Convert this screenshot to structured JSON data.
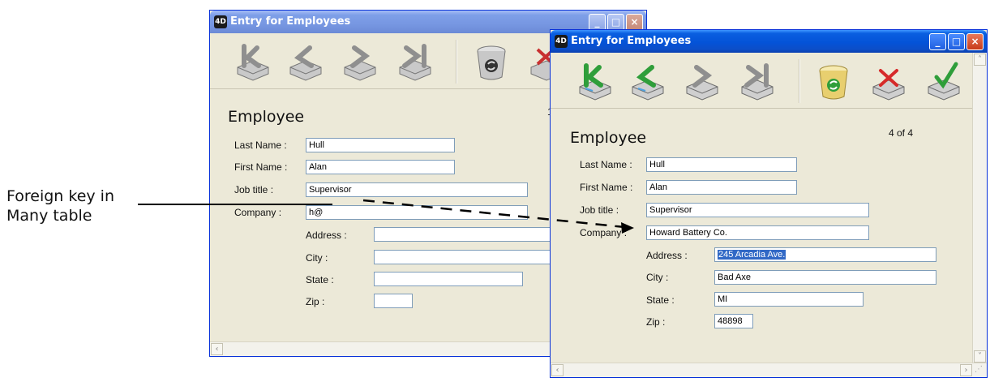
{
  "annotation": {
    "line1": "Foreign key in",
    "line2": "Many table"
  },
  "back_window": {
    "title": "Entry for Employees",
    "title_icon": "4D",
    "form_title": "Employee",
    "counter": "1",
    "fields": {
      "last_name": {
        "label": "Last Name :",
        "value": "Hull"
      },
      "first_name": {
        "label": "First Name :",
        "value": "Alan"
      },
      "job_title": {
        "label": "Job title :",
        "value": "Supervisor"
      },
      "company": {
        "label": "Company :",
        "value": "h@"
      },
      "address": {
        "label": "Address :",
        "value": ""
      },
      "city": {
        "label": "City :",
        "value": ""
      },
      "state": {
        "label": "State :",
        "value": ""
      },
      "zip": {
        "label": "Zip :",
        "value": ""
      }
    }
  },
  "front_window": {
    "title": "Entry for Employees",
    "title_icon": "4D",
    "form_title": "Employee",
    "counter": "4 of 4",
    "fields": {
      "last_name": {
        "label": "Last Name :",
        "value": "Hull"
      },
      "first_name": {
        "label": "First Name :",
        "value": "Alan"
      },
      "job_title": {
        "label": "Job title :",
        "value": "Supervisor"
      },
      "company": {
        "label": "Company :",
        "value": "Howard Battery Co."
      },
      "address": {
        "label": "Address :",
        "value": "245 Arcadia Ave."
      },
      "city": {
        "label": "City :",
        "value": "Bad Axe"
      },
      "state": {
        "label": "State :",
        "value": "MI"
      },
      "zip": {
        "label": "Zip :",
        "value": "48898"
      }
    }
  },
  "toolbar_icons": [
    "first-record-icon",
    "previous-record-icon",
    "next-record-icon",
    "last-record-icon",
    "delete-record-icon",
    "cancel-icon",
    "accept-icon"
  ],
  "colors": {
    "title_active": "#0453d8",
    "title_inactive": "#7e9fe8",
    "window_bg": "#ece9d8",
    "selection": "#3169c6"
  }
}
